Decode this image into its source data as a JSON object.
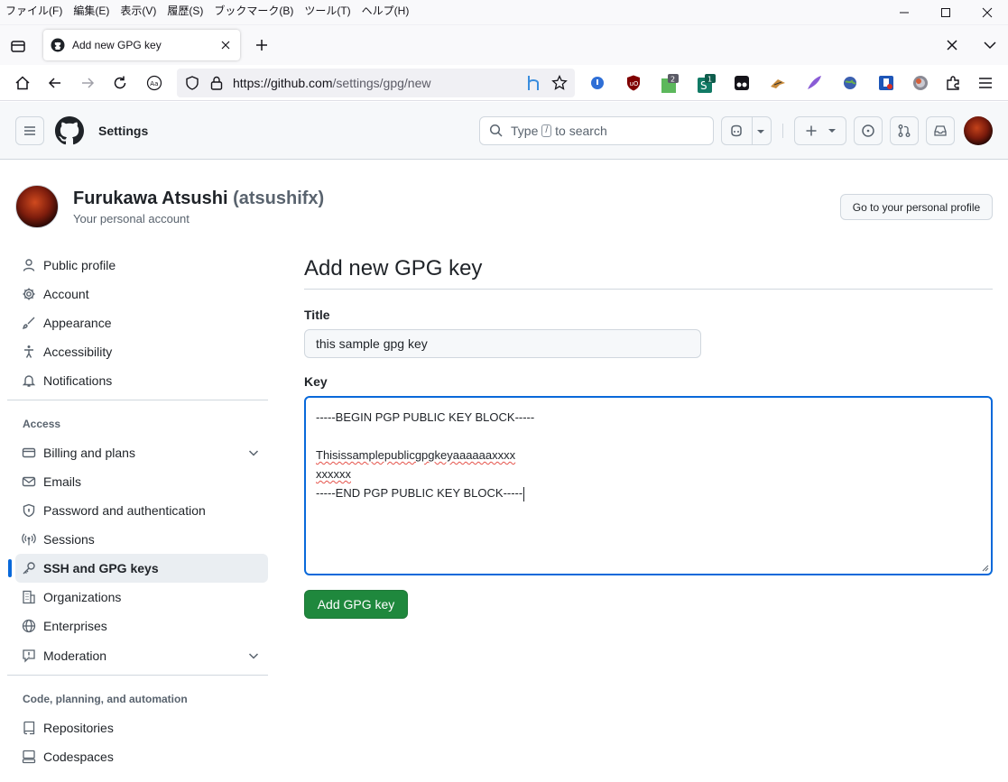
{
  "browser": {
    "menu": [
      "ファイル(F)",
      "編集(E)",
      "表示(V)",
      "履歴(S)",
      "ブックマーク(B)",
      "ツール(T)",
      "ヘルプ(H)"
    ],
    "tab_title": "Add new GPG key",
    "url_host": "https://github.com",
    "url_path": "/settings/gpg/new",
    "ext_badge_1": "2",
    "ext_badge_2": "1"
  },
  "header": {
    "title": "Settings",
    "search_prefix": "Type",
    "search_key": "/",
    "search_suffix": "to search"
  },
  "profile": {
    "name": "Furukawa Atsushi",
    "login": "(atsushifx)",
    "subtitle": "Your personal account",
    "profile_button": "Go to your personal profile"
  },
  "sidebar": {
    "items_top": [
      {
        "label": "Public profile",
        "icon": "person-icon"
      },
      {
        "label": "Account",
        "icon": "gear-icon"
      },
      {
        "label": "Appearance",
        "icon": "paintbrush-icon"
      },
      {
        "label": "Accessibility",
        "icon": "accessibility-icon"
      },
      {
        "label": "Notifications",
        "icon": "bell-icon"
      }
    ],
    "access_heading": "Access",
    "items_access": [
      {
        "label": "Billing and plans",
        "icon": "credit-card-icon"
      },
      {
        "label": "Emails",
        "icon": "mail-icon"
      },
      {
        "label": "Password and authentication",
        "icon": "shield-lock-icon"
      },
      {
        "label": "Sessions",
        "icon": "broadcast-icon"
      },
      {
        "label": "SSH and GPG keys",
        "icon": "key-icon"
      },
      {
        "label": "Organizations",
        "icon": "organization-icon"
      },
      {
        "label": "Enterprises",
        "icon": "globe-icon"
      },
      {
        "label": "Moderation",
        "icon": "report-icon"
      }
    ],
    "code_heading": "Code, planning, and automation",
    "items_code": [
      {
        "label": "Repositories",
        "icon": "repo-icon"
      },
      {
        "label": "Codespaces",
        "icon": "codespaces-icon"
      }
    ]
  },
  "form": {
    "heading": "Add new GPG key",
    "title_label": "Title",
    "title_value": "this sample gpg key",
    "key_label": "Key",
    "key_lines": [
      "-----BEGIN PGP PUBLIC KEY BLOCK-----",
      "",
      "Thisissamplepublicgpgkeyaaaaaaxxxx",
      "xxxxxx",
      "-----END PGP PUBLIC KEY BLOCK-----"
    ],
    "submit_label": "Add GPG key"
  },
  "colors": {
    "accent": "#0969da",
    "primary_button": "#1f883d"
  }
}
